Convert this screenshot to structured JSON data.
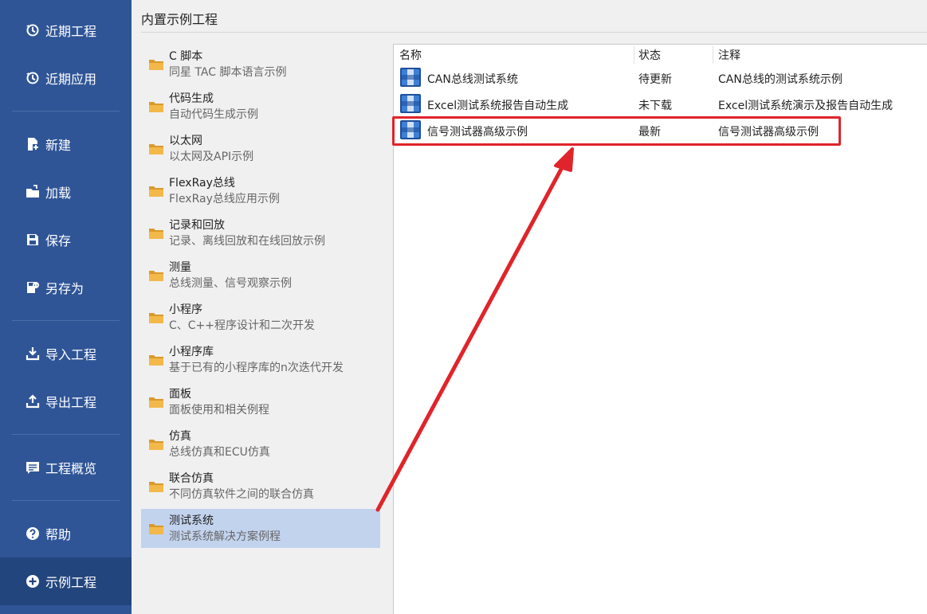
{
  "sidebar": {
    "items": [
      {
        "label": "近期工程",
        "icon": "history-icon"
      },
      {
        "label": "近期应用",
        "icon": "history-icon"
      },
      {
        "label": "新建",
        "icon": "new-file-icon"
      },
      {
        "label": "加载",
        "icon": "open-folder-icon"
      },
      {
        "label": "保存",
        "icon": "save-icon"
      },
      {
        "label": "另存为",
        "icon": "save-as-icon"
      },
      {
        "label": "导入工程",
        "icon": "import-icon"
      },
      {
        "label": "导出工程",
        "icon": "export-icon"
      },
      {
        "label": "工程概览",
        "icon": "overview-icon"
      },
      {
        "label": "帮助",
        "icon": "help-icon"
      },
      {
        "label": "示例工程",
        "icon": "add-circle-icon"
      }
    ],
    "active": "示例工程"
  },
  "main": {
    "title": "内置示例工程",
    "folders": [
      {
        "name": "C 脚本",
        "desc": "同星 TAC 脚本语言示例"
      },
      {
        "name": "代码生成",
        "desc": "自动代码生成示例"
      },
      {
        "name": "以太网",
        "desc": "以太网及API示例"
      },
      {
        "name": "FlexRay总线",
        "desc": "FlexRay总线应用示例"
      },
      {
        "name": "记录和回放",
        "desc": "记录、离线回放和在线回放示例"
      },
      {
        "name": "测量",
        "desc": "总线测量、信号观察示例"
      },
      {
        "name": "小程序",
        "desc": "C、C++程序设计和二次开发"
      },
      {
        "name": "小程序库",
        "desc": "基于已有的小程序库的n次迭代开发"
      },
      {
        "name": "面板",
        "desc": "面板使用和相关例程"
      },
      {
        "name": "仿真",
        "desc": "总线仿真和ECU仿真"
      },
      {
        "name": "联合仿真",
        "desc": "不同仿真软件之间的联合仿真"
      },
      {
        "name": "测试系统",
        "desc": "测试系统解决方案例程"
      }
    ],
    "selected_folder": "测试系统",
    "table": {
      "headers": [
        "名称",
        "状态",
        "注释"
      ],
      "rows": [
        {
          "name": "CAN总线测试系统",
          "status": "待更新",
          "note": "CAN总线的测试系统示例"
        },
        {
          "name": "Excel测试系统报告自动生成",
          "status": "未下载",
          "note": "Excel测试系统演示及报告自动生成"
        },
        {
          "name": "信号测试器高级示例",
          "status": "最新",
          "note": "信号测试器高级示例"
        }
      ]
    }
  },
  "colors": {
    "sidebar_bg": "#2f5597",
    "sidebar_active": "#23457d",
    "selected_row": "#c2d3ee",
    "annotation": "#e0242b",
    "folder": "#e8a735"
  }
}
